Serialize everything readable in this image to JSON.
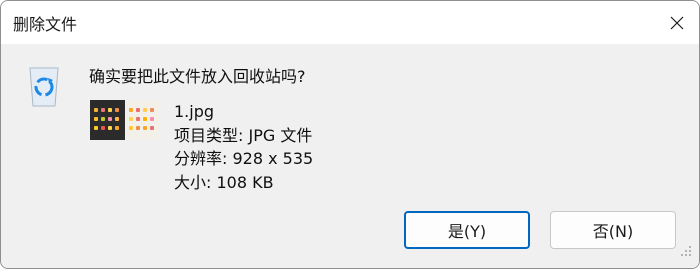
{
  "window": {
    "title": "删除文件"
  },
  "message": {
    "question": "确实要把此文件放入回收站吗?"
  },
  "file": {
    "name": "1.jpg",
    "type_line": "项目类型: JPG 文件",
    "resolution_line": "分辨率: 928 x 535",
    "size_line": "大小: 108 KB"
  },
  "buttons": {
    "yes": "是(Y)",
    "no": "否(N)"
  },
  "icons": {
    "close": "close-icon",
    "recycle": "recycle-bin-icon"
  }
}
